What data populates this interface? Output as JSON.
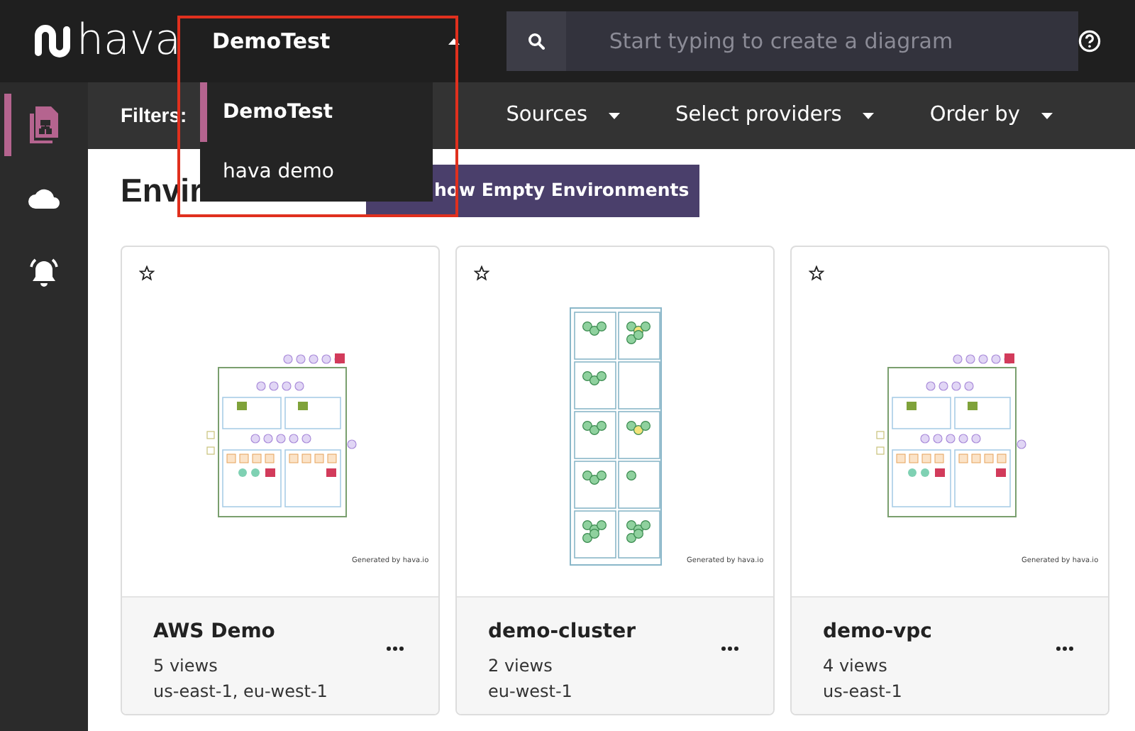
{
  "logo": {
    "text": "hava"
  },
  "workspace_selector": {
    "label": "DemoTest",
    "expanded": true
  },
  "search": {
    "placeholder": "Start typing to create a diagram"
  },
  "sidebar": {
    "items": [
      {
        "kind": "diagrams",
        "selected": true
      },
      {
        "kind": "cloud",
        "selected": false
      },
      {
        "kind": "alerts",
        "selected": false
      }
    ]
  },
  "filters": {
    "label": "Filters:",
    "dropdowns": [
      "Sources",
      "Select providers",
      "Order by"
    ]
  },
  "page_title": "Envir",
  "show_empty_button": "how Empty Environments",
  "workspace_menu": {
    "items": [
      {
        "label": "DemoTest",
        "selected": true
      },
      {
        "label": "hava demo",
        "selected": false
      }
    ]
  },
  "environments": [
    {
      "name": "AWS Demo",
      "views": "5 views",
      "regions": "us-east-1, eu-west-1",
      "kind": "vpc",
      "credit": "Generated by hava.io"
    },
    {
      "name": "demo-cluster",
      "views": "2 views",
      "regions": "eu-west-1",
      "kind": "cluster",
      "credit": "Generated by hava.io"
    },
    {
      "name": "demo-vpc",
      "views": "4 views",
      "regions": "us-east-1",
      "kind": "vpc",
      "credit": "Generated by hava.io"
    }
  ]
}
